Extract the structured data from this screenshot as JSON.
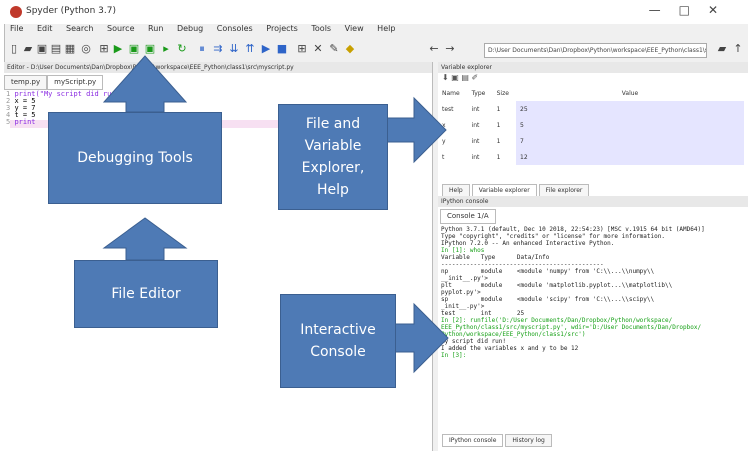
{
  "window": {
    "title": "Spyder (Python 3.7)",
    "controls": [
      "—",
      "□",
      "✕"
    ]
  },
  "menu": [
    "File",
    "Edit",
    "Search",
    "Source",
    "Run",
    "Debug",
    "Consoles",
    "Projects",
    "Tools",
    "View",
    "Help"
  ],
  "toolbar": {
    "path": "D:\\User Documents\\Dan\\Dropbox\\Python\\workspace\\EEE_Python\\class1\\src"
  },
  "editor": {
    "header": "Editor - D:\\User Documents\\Dan\\Dropbox\\Python\\workspace\\EEE_Python\\class1\\src\\myscript.py",
    "tabs": [
      "temp.py",
      "myScript.py"
    ],
    "lines": [
      {
        "num": "1",
        "text": "print(\"My script did ru"
      },
      {
        "num": "2",
        "text": "x = 5"
      },
      {
        "num": "3",
        "text": "y = 7"
      },
      {
        "num": "4",
        "text": "t = 5"
      },
      {
        "num": "5",
        "text": "print"
      }
    ]
  },
  "variable_explorer": {
    "header": "Variable explorer",
    "columns": [
      "Name",
      "Type",
      "Size",
      "Value"
    ],
    "rows": [
      {
        "name": "test",
        "type": "int",
        "size": "1",
        "value": "25"
      },
      {
        "name": "x",
        "type": "int",
        "size": "1",
        "value": "5"
      },
      {
        "name": "y",
        "type": "int",
        "size": "1",
        "value": "7"
      },
      {
        "name": "t",
        "type": "int",
        "size": "1",
        "value": "12"
      }
    ],
    "bottom_tabs": [
      "Help",
      "Variable explorer",
      "File explorer"
    ]
  },
  "console": {
    "header": "IPython console",
    "tab": "Console 1/A",
    "lines": [
      "Python 3.7.1 (default, Dec 10 2018, 22:54:23) [MSC v.1915 64 bit (AMD64)]",
      "Type \"copyright\", \"credits\" or \"license\" for more information.",
      "",
      "IPython 7.2.0 -- An enhanced Interactive Python.",
      "",
      "In [1]: whos",
      "Variable   Type      Data/Info",
      "---------------------------------------------",
      "np         module    <module 'numpy' from 'C:\\\\...\\\\numpy\\\\",
      "__init__.py'>",
      "plt        module    <module 'matplotlib.pyplot...\\\\matplotlib\\\\",
      "pyplot.py'>",
      "sp         module    <module 'scipy' from 'C:\\\\...\\\\scipy\\\\",
      "_init__.py'>",
      "test       int       25",
      "",
      "In [2]: runfile('D:/User Documents/Dan/Dropbox/Python/workspace/",
      "EEE_Python/class1/src/myscript.py', wdir='D:/User Documents/Dan/Dropbox/",
      "Python/workspace/EEE_Python/class1/src')",
      "My script did run!",
      "I added the variables x and y to be 12",
      "",
      "In [3]:"
    ],
    "bottom_tabs": [
      "IPython console",
      "History log"
    ]
  },
  "callouts": {
    "debugging": "Debugging Tools",
    "file_editor": "File Editor",
    "file_var_line1": "File and",
    "file_var_line2": "Variable",
    "file_var_line3": "Explorer,",
    "file_var_line4": "Help",
    "console_line1": "Interactive",
    "console_line2": "Console"
  },
  "colors": {
    "callout": "#4e7ab5",
    "run_green": "#1a9a1a",
    "debug_blue": "#2e64c8"
  }
}
